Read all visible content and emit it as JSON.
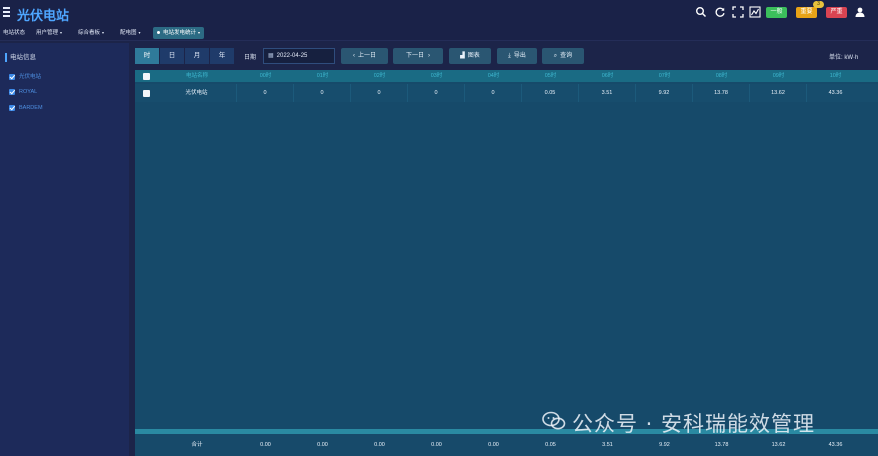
{
  "app": {
    "title": "光伏电站"
  },
  "header_actions": {
    "normal_label": "一般",
    "important_label": "重要",
    "important_count": "3",
    "severe_label": "严重"
  },
  "nav": {
    "tabs": [
      {
        "label": "电站状态",
        "has_dropdown": false
      },
      {
        "label": "用户管理",
        "has_dropdown": true
      },
      {
        "label": "综合看板",
        "has_dropdown": true
      },
      {
        "label": "配电图",
        "has_dropdown": true
      },
      {
        "label": "电站发电统计",
        "has_dropdown": true,
        "active": true
      }
    ]
  },
  "sidebar": {
    "title": "电站信息",
    "items": [
      {
        "label": "光伏电站",
        "checked": true
      },
      {
        "label": "ROYAL",
        "checked": true
      },
      {
        "label": "BARDEM",
        "checked": true
      }
    ]
  },
  "toolbar": {
    "periods": [
      "时",
      "日",
      "月",
      "年"
    ],
    "active_period": "时",
    "date_label": "日期",
    "date_value": "2022-04-25",
    "prev_label": "上一日",
    "next_label": "下一日",
    "chart_label": "图表",
    "export_label": "导出",
    "query_label": "查询",
    "unit_label": "单位: kW·h"
  },
  "table": {
    "columns": [
      "电站名称",
      "00时",
      "01时",
      "02时",
      "03时",
      "04时",
      "05时",
      "06时",
      "07时",
      "08时",
      "09时",
      "10时"
    ],
    "rows": [
      {
        "cells": [
          "光伏电站",
          "0",
          "0",
          "0",
          "0",
          "0",
          "0.05",
          "3.51",
          "9.92",
          "13.78",
          "13.62",
          "43.36"
        ]
      }
    ],
    "footer": [
      "合计",
      "0.00",
      "0.00",
      "0.00",
      "0.00",
      "0.00",
      "0.05",
      "3.51",
      "9.92",
      "13.78",
      "13.62",
      "43.36"
    ]
  },
  "watermark": {
    "text": "公众号 · 安科瑞能效管理"
  },
  "colors": {
    "accent": "#4ea6ff",
    "normal": "#3bbf5c",
    "important": "#e8a317",
    "severe": "#d94452"
  }
}
